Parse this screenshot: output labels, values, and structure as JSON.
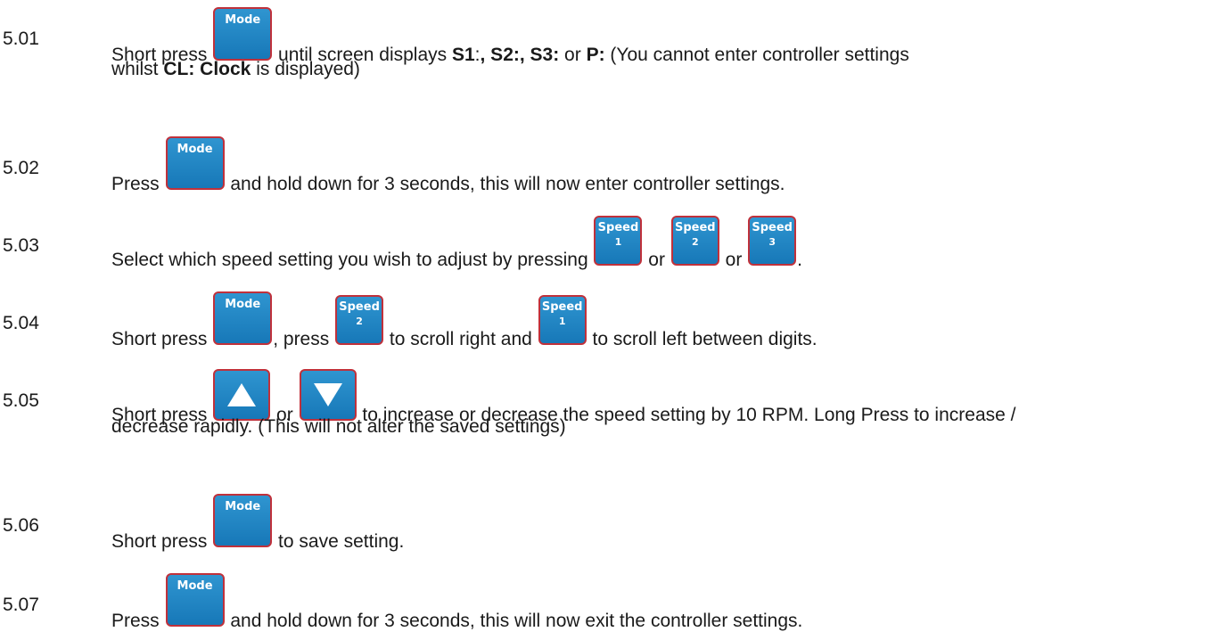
{
  "keys": {
    "mode": "Mode",
    "speed": "Speed",
    "speed1": "1",
    "speed2": "2",
    "speed3": "3"
  },
  "steps": [
    {
      "num": "5.01",
      "a": "Short press ",
      "b": " until screen displays ",
      "s1": "S1",
      "colon1": ":",
      "comma_s2": ", S2:, S3:",
      "or": " or ",
      "p": "P:",
      "c": " (You cannot enter controller settings",
      "d": "whilst ",
      "clock": "CL: Clock",
      "e": " is displayed)"
    },
    {
      "num": "5.02",
      "a": "Press ",
      "b": " and hold down for 3 seconds, this will now enter controller settings."
    },
    {
      "num": "5.03",
      "a": "Select which speed setting you wish to adjust by pressing ",
      "or1": " or ",
      "or2": " or ",
      "end": "."
    },
    {
      "num": "5.04",
      "a": "Short press ",
      "b": ", press ",
      "c": " to scroll right and ",
      "d": " to scroll left between digits."
    },
    {
      "num": "5.05",
      "a": "Short press ",
      "or": " or ",
      "b": " to increase or decrease the speed setting by 10 RPM. Long Press to increase /",
      "c": "decrease rapidly. (This will not alter the saved settings)"
    },
    {
      "num": "5.06",
      "a": "Short press ",
      "b": " to save setting."
    },
    {
      "num": "5.07",
      "a": "Press ",
      "b": " and hold down for 3 seconds, this will now exit the controller settings."
    }
  ]
}
